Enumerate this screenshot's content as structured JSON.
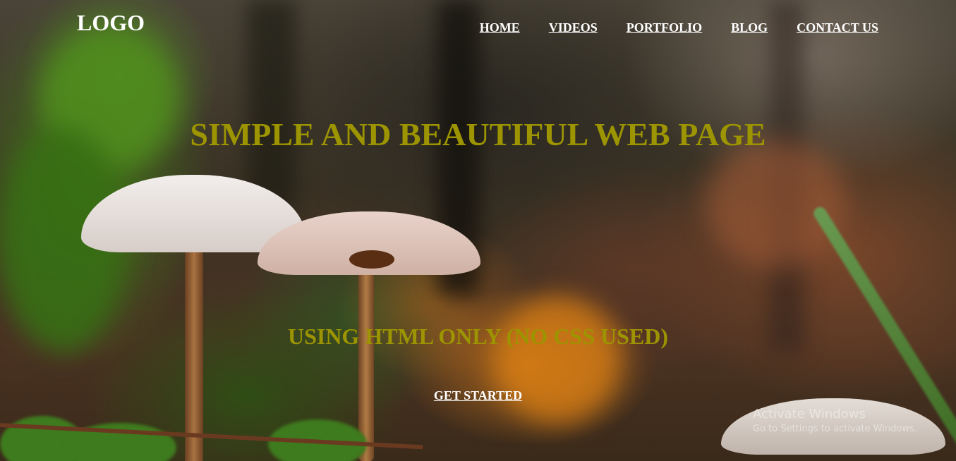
{
  "header": {
    "logo": "LOGO",
    "nav": [
      {
        "label": "HOME"
      },
      {
        "label": "VIDEOS"
      },
      {
        "label": "PORTFOLIO"
      },
      {
        "label": "BLOG"
      },
      {
        "label": "CONTACT US"
      }
    ]
  },
  "hero": {
    "title": "SIMPLE AND BEAUTIFUL WEB PAGE",
    "subtitle": "USING HTML ONLY (NO CSS USED)",
    "cta_label": "GET STARTED"
  },
  "watermark": {
    "title": "Activate Windows",
    "subtitle": "Go to Settings to activate Windows."
  },
  "colors": {
    "heading": "#9c9400",
    "nav_text": "#ffffff"
  }
}
